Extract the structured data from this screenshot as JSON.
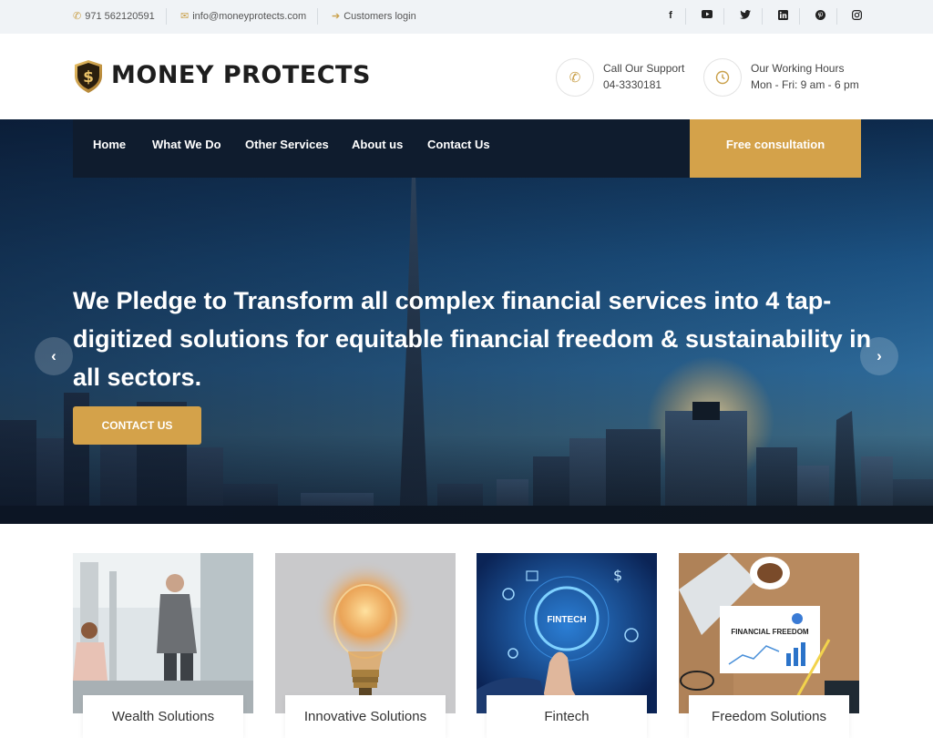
{
  "topbar": {
    "phone": "971 562120591",
    "email": "info@moneyprotects.com",
    "login": "Customers login",
    "social": [
      "facebook-icon",
      "youtube-icon",
      "twitter-icon",
      "linkedin-icon",
      "pinterest-icon",
      "instagram-icon"
    ]
  },
  "header": {
    "logo_text": "MONEY PROTECTS",
    "support": {
      "title": "Call Our Support",
      "value": "04-3330181"
    },
    "hours": {
      "title": "Our Working Hours",
      "value": "Mon - Fri: 9 am - 6 pm"
    }
  },
  "nav": {
    "items": [
      "Home",
      "What We Do",
      "Other Services",
      "About us",
      "Contact Us"
    ],
    "cta": "Free consultation"
  },
  "hero": {
    "title": "We Pledge to Transform all complex financial services into 4 tap-digitized solutions for equitable financial freedom & sustainability in all sectors.",
    "button": "CONTACT US"
  },
  "cards": [
    {
      "label": "Wealth Solutions"
    },
    {
      "label": "Innovative Solutions"
    },
    {
      "label": "Fintech",
      "image_text": "FINTECH"
    },
    {
      "label": "Freedom Solutions",
      "image_text": "FINANCIAL FREEDOM"
    }
  ],
  "colors": {
    "accent": "#d4a24a",
    "nav_bg": "#0f1c2e",
    "topbar_bg": "#f0f3f6"
  }
}
